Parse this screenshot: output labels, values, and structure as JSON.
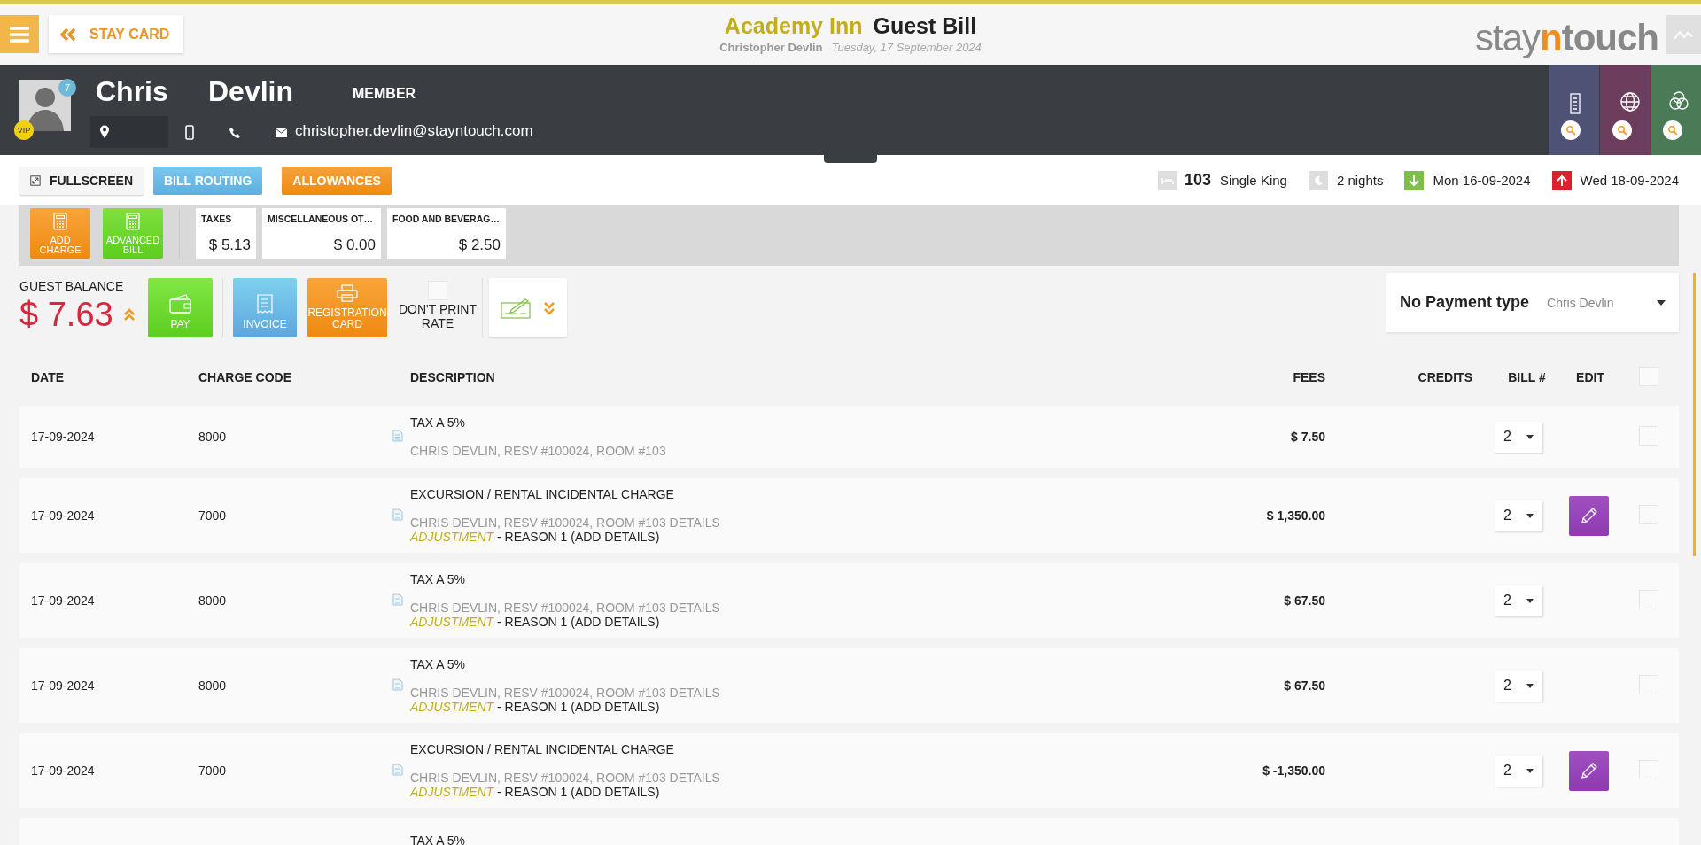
{
  "header": {
    "stay_card_button": "STAY CARD",
    "hotel": "Academy Inn",
    "page_title": "Guest Bill",
    "guest_name": "Christopher Devlin",
    "date": "Tuesday, 17 September 2024",
    "logo": [
      "stay",
      "n",
      "touch"
    ]
  },
  "guest": {
    "first_name": "Chris",
    "last_name": "Devlin",
    "membership": "MEMBER",
    "badge_count": "7",
    "vip": "VIP",
    "email": "christopher.devlin@stayntouch.com"
  },
  "toolbar": {
    "buttons": [
      {
        "label": "FULLSCREEN",
        "kind": "fullscreen"
      },
      {
        "label": "BILL ROUTING",
        "kind": "routing"
      },
      {
        "label": "ALLOWANCES",
        "kind": "allowances"
      }
    ],
    "room_number": "103",
    "room_type": "Single King",
    "nights": "2 nights",
    "arrival": "Mon 16-09-2024",
    "departure": "Wed 18-09-2024"
  },
  "bill_actions": [
    {
      "label": "ADD CHARGE",
      "kind": "add"
    },
    {
      "label": "ADVANCED BILL",
      "kind": "advanced"
    }
  ],
  "summaries": [
    {
      "label": "TAXES",
      "amount": "$ 5.13"
    },
    {
      "label": "MISCELLANEOUS OT…",
      "amount": "$ 0.00"
    },
    {
      "label": "FOOD AND BEVERAG…",
      "amount": "$ 2.50"
    }
  ],
  "balance": {
    "label": "GUEST BALANCE",
    "amount": "$ 7.63",
    "buttons": [
      {
        "label": "PAY",
        "kind": "pay"
      },
      {
        "label": "INVOICE",
        "kind": "invoice"
      },
      {
        "label": "REGISTRATION CARD",
        "kind": "registration"
      }
    ],
    "dont_print_rate": {
      "label": "DON'T PRINT RATE",
      "checked": false
    }
  },
  "payment": {
    "type": "No Payment type",
    "payer": "Chris Devlin"
  },
  "table": {
    "columns": [
      "DATE",
      "CHARGE CODE",
      "DESCRIPTION",
      "FEES",
      "CREDITS",
      "BILL #",
      "EDIT"
    ],
    "select_all": {
      "checked": false
    },
    "rows": [
      {
        "date": "17-09-2024",
        "code": "8000",
        "title": "TAX A 5%",
        "details": "CHRIS DEVLIN, RESV #100024, ROOM #103",
        "fees": "$ 7.50",
        "bill": "2",
        "editable": false,
        "checked": false
      },
      {
        "date": "17-09-2024",
        "code": "7000",
        "title": "EXCURSION / RENTAL INCIDENTAL CHARGE",
        "details": "CHRIS DEVLIN, RESV #100024, ROOM #103 DETAILS",
        "adjustment": "*ADJUSTMENT* - REASON 1 (ADD DETAILS)",
        "fees": "$ 1,350.00",
        "bill": "2",
        "editable": true,
        "checked": false
      },
      {
        "date": "17-09-2024",
        "code": "8000",
        "title": "TAX A 5%",
        "details": "CHRIS DEVLIN, RESV #100024, ROOM #103 DETAILS",
        "adjustment": "*ADJUSTMENT* - REASON 1 (ADD DETAILS)",
        "fees": "$ 67.50",
        "bill": "2",
        "editable": false,
        "checked": false
      },
      {
        "date": "17-09-2024",
        "code": "8000",
        "title": "TAX A 5%",
        "details": "CHRIS DEVLIN, RESV #100024, ROOM #103 DETAILS",
        "adjustment": "*ADJUSTMENT* - REASON 1 (ADD DETAILS)",
        "fees": "$ 67.50",
        "bill": "2",
        "editable": false,
        "checked": false
      },
      {
        "date": "17-09-2024",
        "code": "7000",
        "title": "EXCURSION / RENTAL INCIDENTAL CHARGE",
        "details": "CHRIS DEVLIN, RESV #100024, ROOM #103 DETAILS",
        "adjustment": "*ADJUSTMENT* - REASON 1 (ADD DETAILS)",
        "fees": "$ -1,350.00",
        "bill": "2",
        "editable": true,
        "checked": false
      },
      {
        "title": "TAX A 5%",
        "kind": "partial"
      }
    ]
  }
}
